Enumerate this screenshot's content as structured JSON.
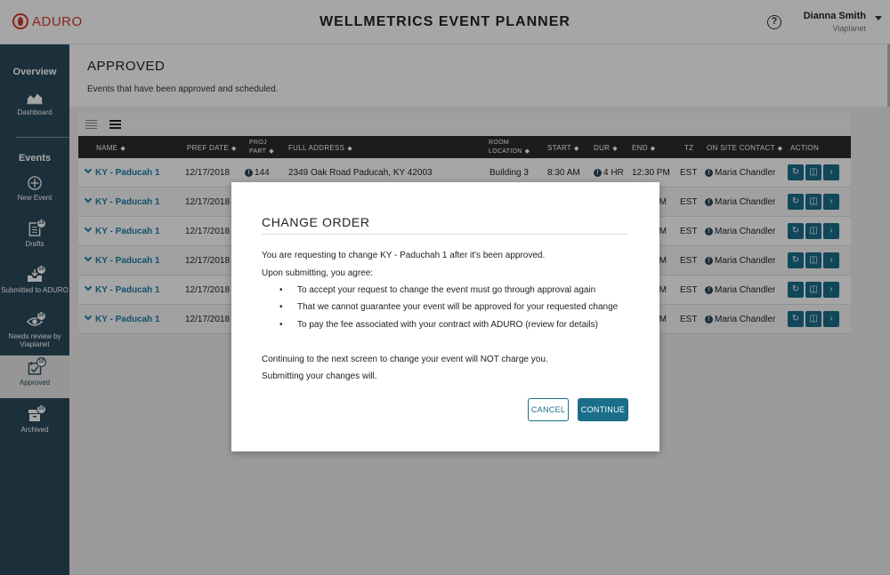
{
  "app": {
    "brand": "ADURO",
    "title": "WELLMETRICS EVENT PLANNER",
    "help_icon": "?",
    "user_name": "Dianna Smith",
    "user_org": "Viaplanet"
  },
  "sidebar": {
    "overview_heading": "Overview",
    "dashboard_label": "Dashboard",
    "events_heading": "Events",
    "items": [
      {
        "label": "New Event",
        "icon": "plus-circle-icon",
        "badge": ""
      },
      {
        "label": "Drafts",
        "icon": "document-icon",
        "badge": "10"
      },
      {
        "label": "Submitted to ADURO",
        "icon": "tray-icon",
        "badge": "10"
      },
      {
        "label": "Needs review by Viaplanet",
        "icon": "eye-icon",
        "badge": "10"
      },
      {
        "label": "Approved",
        "icon": "calendar-check-icon",
        "badge": "10"
      },
      {
        "label": "Archived",
        "icon": "archive-box-icon",
        "badge": "10"
      }
    ]
  },
  "page": {
    "title": "APPROVED",
    "subtitle": "Events that have been approved and scheduled."
  },
  "table": {
    "columns": {
      "name": "NAME",
      "pref_date": "PREF DATE",
      "proj_part_1": "PROJ",
      "proj_part_2": "PART",
      "full_address": "FULL ADDRESS",
      "room_1": "ROOM",
      "room_2": "LOCATION",
      "start": "START",
      "dur": "DUR",
      "end": "END",
      "tz": "TZ",
      "contact": "ON SITE CONTACT",
      "action": "ACTION"
    },
    "rows": [
      {
        "name": "KY - Paducah 1",
        "date": "12/17/2018",
        "proj": "144",
        "address": "2349 Oak Road Paducah, KY 42003",
        "room": "Building 3",
        "start": "8:30 AM",
        "dur": "4 HR",
        "end": "12:30 PM",
        "tz": "EST",
        "contact": "Maria Chandler"
      },
      {
        "name": "KY - Paducah 1",
        "date": "12/17/2018",
        "end": "PM",
        "tz": "EST",
        "contact": "Maria Chandler"
      },
      {
        "name": "KY - Paducah 1",
        "date": "12/17/2018",
        "end": "PM",
        "tz": "EST",
        "contact": "Maria Chandler"
      },
      {
        "name": "KY - Paducah 1",
        "date": "12/17/2018",
        "end": "PM",
        "tz": "EST",
        "contact": "Maria Chandler"
      },
      {
        "name": "KY - Paducah 1",
        "date": "12/17/2018",
        "end": "PM",
        "tz": "EST",
        "contact": "Maria Chandler"
      },
      {
        "name": "KY - Paducah 1",
        "date": "12/17/2018",
        "end": "PM",
        "tz": "EST",
        "contact": "Maria Chandler"
      }
    ]
  },
  "modal": {
    "title": "CHANGE ORDER",
    "line1": "You are requesting to change KY - Paduchah 1 after it's been approved.",
    "line2": "Upon submitting, you agree:",
    "bullets": [
      "To accept your request to change the event must go through approval again",
      "That we cannot guarantee your event will be approved for your requested change",
      "To pay the fee associated with your contract with ADURO (review for details)"
    ],
    "line3": "Continuing to the next screen to change your event will NOT charge you.",
    "line4": "Submitting your changes will.",
    "cancel_label": "CANCEL",
    "continue_label": "CONTINUE"
  },
  "colors": {
    "sidebar": "#2c4a5b",
    "accent": "#1a6e8a",
    "brand": "#d7392f",
    "table_header": "#2b2b2b"
  }
}
